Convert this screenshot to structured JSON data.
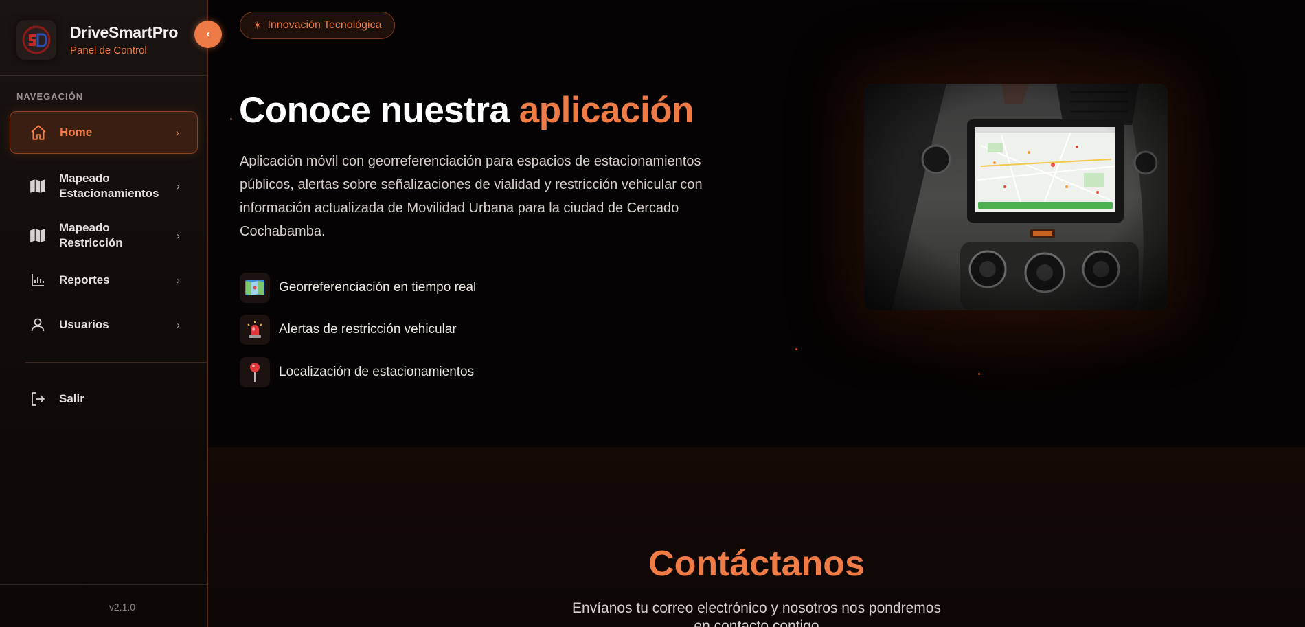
{
  "sidebar": {
    "brand_title": "DriveSmartPro",
    "brand_subtitle": "Panel de Control",
    "collapse_icon": "‹",
    "nav_heading": "NAVEGACIÓN",
    "items": [
      {
        "label": "Home",
        "icon": "home-icon",
        "active": true
      },
      {
        "label": "Mapeado Estacionamientos",
        "icon": "map-icon",
        "active": false
      },
      {
        "label": "Mapeado Restricción",
        "icon": "map-icon",
        "active": false
      },
      {
        "label": "Reportes",
        "icon": "bar-chart-icon",
        "active": false
      },
      {
        "label": "Usuarios",
        "icon": "user-icon",
        "active": false
      }
    ],
    "logout_label": "Salir",
    "version": "v2.1.0"
  },
  "hero": {
    "badge": "Innovación Tecnológica",
    "title_main": "Conoce nuestra ",
    "title_accent": "aplicación",
    "description": "Aplicación móvil con georreferenciación para espacios de estacionamientos públicos, alertas sobre señalizaciones de vialidad y restricción vehicular con información actualizada de Movilidad Urbana para la ciudad de Cercado Cochabamba.",
    "features": [
      {
        "icon": "🗺️",
        "text": "Georreferenciación en tiempo real"
      },
      {
        "icon": "🚨",
        "text": "Alertas de restricción vehicular"
      },
      {
        "icon": "📍",
        "text": "Localización de estacionamientos"
      }
    ]
  },
  "contact": {
    "title": "Contáctanos",
    "subtitle_line1": "Envíanos tu correo electrónico y nosotros nos pondremos",
    "subtitle_line2": "en contacto contigo"
  },
  "colors": {
    "accent": "#ef7b46",
    "background": "#050303",
    "sidebar": "#16110f"
  }
}
